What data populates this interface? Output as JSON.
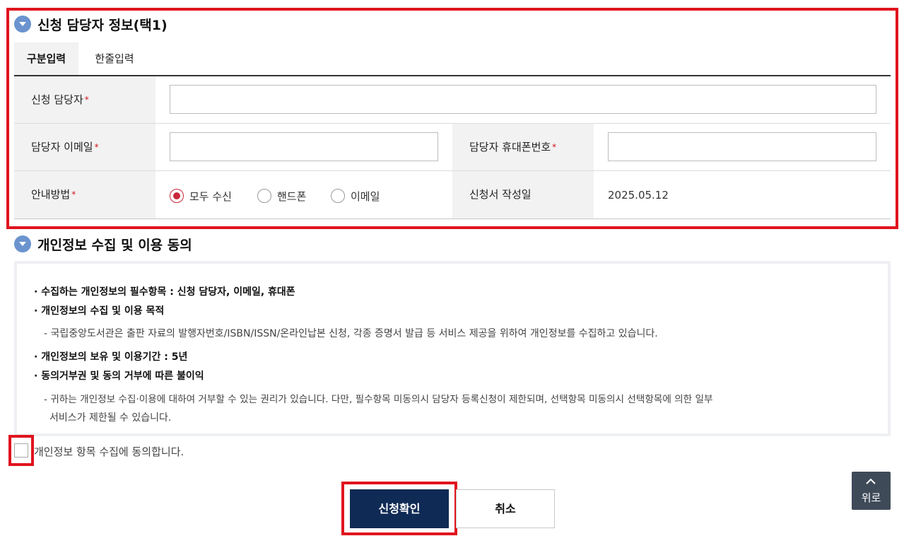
{
  "section1": {
    "title": "신청 담당자 정보(택1)",
    "tabs": [
      "구분입력",
      "한줄입력"
    ],
    "fields": {
      "manager_label": "신청 담당자",
      "email_label": "담당자 이메일",
      "phone_label": "담당자 휴대폰번호",
      "method_label": "안내방법",
      "date_label": "신청서 작성일",
      "date_value": "2025.05.12",
      "required_mark": "*"
    },
    "methods": [
      "모두 수신",
      "핸드폰",
      "이메일"
    ],
    "selected_method": "모두 수신"
  },
  "section2": {
    "title": "개인정보 수집 및 이용 동의",
    "lines": {
      "l1": "· 수집하는 개인정보의 필수항목 : 신청 담당자, 이메일, 휴대폰",
      "l2": "· 개인정보의 수집 및 이용 목적",
      "l3": "- 국립중앙도서관은 출판 자료의 발행자번호/ISBN/ISSN/온라인납본 신청, 각종 증명서 발급 등 서비스 제공을 위하여 개인정보를 수집하고 있습니다.",
      "l4": "· 개인정보의 보유 및 이용기간 : 5년",
      "l5": "· 동의거부권 및 동의 거부에 따른 불이익",
      "l6": "- 귀하는 개인정보 수집·이용에 대하여 거부할 수 있는 권리가 있습니다. 다만, 필수항목 미동의시 담당자 등록신청이 제한되며, 선택항목 미동의시 선택항목에 의한 일부",
      "l7": "서비스가 제한될 수 있습니다."
    },
    "agree_label": "개인정보 항목 수집에 동의합니다."
  },
  "buttons": {
    "submit": "신청확인",
    "cancel": "취소"
  },
  "top_button": "위로",
  "colors": {
    "accent_red": "#e0141e",
    "navy": "#0f2a54",
    "icon_blue": "#6b94cf"
  }
}
